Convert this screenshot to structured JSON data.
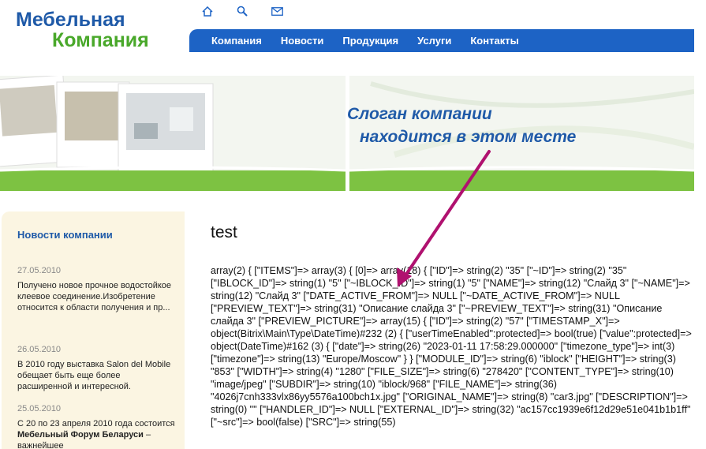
{
  "logo": {
    "line1": "Мебельная",
    "line2": "Компания"
  },
  "top_icons": [
    "home-icon",
    "search-icon",
    "mail-icon"
  ],
  "nav": {
    "items": [
      "Компания",
      "Новости",
      "Продукция",
      "Услуги",
      "Контакты"
    ]
  },
  "banner": {
    "slogan_line1": "Слоган компании",
    "slogan_line2": "находится в этом месте"
  },
  "sidebar": {
    "title": "Новости компании",
    "news": [
      {
        "date": "27.05.2010",
        "text": "Получено новое прочное водостойкое клеевое соединение.Изобретение относится к области получения и пр..."
      },
      {
        "date": "26.05.2010",
        "text": "В 2010 году выставка Salon del Mobile обещает быть еще более расширенной и интересной."
      },
      {
        "date": "25.05.2010",
        "text_start": "С 20 по 23 апреля 2010 года состоится ",
        "text_bold": "Мебельный Форум Беларуси",
        "text_end": " – важнейшее"
      }
    ]
  },
  "content": {
    "title": "test",
    "dump": "array(2) { [\"ITEMS\"]=> array(3) { [0]=> array(18) { [\"ID\"]=> string(2) \"35\" [\"~ID\"]=> string(2) \"35\" [\"IBLOCK_ID\"]=> string(1) \"5\" [\"~IBLOCK_ID\"]=> string(1) \"5\" [\"NAME\"]=> string(12) \"Слайд 3\" [\"~NAME\"]=> string(12) \"Слайд 3\" [\"DATE_ACTIVE_FROM\"]=> NULL [\"~DATE_ACTIVE_FROM\"]=> NULL [\"PREVIEW_TEXT\"]=> string(31) \"Описание слайда 3\" [\"~PREVIEW_TEXT\"]=> string(31) \"Описание слайда 3\" [\"PREVIEW_PICTURE\"]=> array(15) { [\"ID\"]=> string(2) \"57\" [\"TIMESTAMP_X\"]=> object(Bitrix\\Main\\Type\\DateTime)#232 (2) { [\"userTimeEnabled\":protected]=> bool(true) [\"value\":protected]=> object(DateTime)#162 (3) { [\"date\"]=> string(26) \"2023-01-11 17:58:29.000000\" [\"timezone_type\"]=> int(3) [\"timezone\"]=> string(13) \"Europe/Moscow\" } } [\"MODULE_ID\"]=> string(6) \"iblock\" [\"HEIGHT\"]=> string(3) \"853\" [\"WIDTH\"]=> string(4) \"1280\" [\"FILE_SIZE\"]=> string(6) \"278420\" [\"CONTENT_TYPE\"]=> string(10) \"image/jpeg\" [\"SUBDIR\"]=> string(10) \"iblock/968\" [\"FILE_NAME\"]=> string(36) \"4026j7cnh333vlx86yy5576a100bch1x.jpg\" [\"ORIGINAL_NAME\"]=> string(8) \"car3.jpg\" [\"DESCRIPTION\"]=> string(0) \"\" [\"HANDLER_ID\"]=> NULL [\"EXTERNAL_ID\"]=> string(32) \"ac157cc1939e6f12d29e51e041b1b1ff\" [\"~src\"]=> bool(false) [\"SRC\"]=> string(55)"
  },
  "colors": {
    "brand_blue": "#1f5aa8",
    "brand_green": "#49a82a",
    "nav_bg": "#1d63c5",
    "arrow": "#b0116f"
  }
}
